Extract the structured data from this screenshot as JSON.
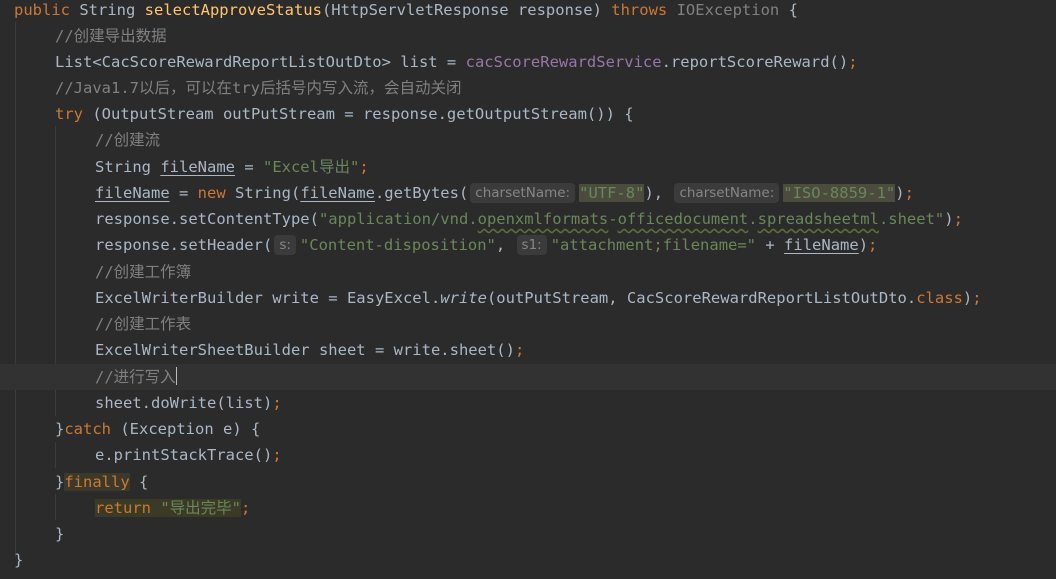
{
  "code": {
    "l1": {
      "public": "public ",
      "type": "String ",
      "method": "selectApproveStatus",
      "params": "(HttpServletResponse response) ",
      "throws": "throws ",
      "exc": "IOException",
      "brace": " {"
    },
    "l2": {
      "comment": "//创建导出数据"
    },
    "l3": {
      "decl": "List<CacScoreRewardReportListOutDto> list = ",
      "field": "cacScoreRewardService",
      "call": ".reportScoreReward()",
      "semi": ";"
    },
    "l4": {
      "comment": "//Java1.7以后，可以在try后括号内写入流，会自动关闭"
    },
    "l5": {
      "try": "try ",
      "rest": "(OutputStream outPutStream = response.getOutputStream()) {"
    },
    "l6": {
      "comment": "//创建流"
    },
    "l7": {
      "type": "String ",
      "var": "fileName",
      "eq": " = ",
      "str": "\"Excel导出\"",
      "semi": ";"
    },
    "l8": {
      "var": "fileName",
      "eq": " = ",
      "new": "new ",
      "ctor": "String(",
      "var2": "fileName",
      "call": ".getBytes(",
      "hint1": "charsetName:",
      "str1": "\"UTF-8\"",
      "mid": "),",
      "hint2": "charsetName:",
      "str2": "\"ISO-8859-1\"",
      "end": ")",
      "semi": ";"
    },
    "l9": {
      "pre": "response.setContentType(",
      "s_a": "\"application/vnd.",
      "s_b": "openxmlformats",
      "s_c": "-",
      "s_d": "officedocument",
      "s_e": ".",
      "s_f": "spreadsheetml",
      "s_g": ".sheet\"",
      "end": ")",
      "semi": ";"
    },
    "l10": {
      "pre": "response.setHeader(",
      "hint1": "s:",
      "str1": "\"Content-disposition\"",
      "comma": ", ",
      "hint2": "s1:",
      "str2": "\"attachment;filename=\"",
      "plus": " + ",
      "var": "fileName",
      "end": ")",
      "semi": ";"
    },
    "l11": {
      "comment": "//创建工作簿"
    },
    "l12": {
      "pre": "ExcelWriterBuilder write = EasyExcel.",
      "write": "write",
      "args": "(outPutStream, CacScoreRewardReportListOutDto.",
      "cls": "class",
      "end": ")",
      "semi": ";"
    },
    "l13": {
      "comment": "//创建工作表"
    },
    "l14": {
      "pre": "ExcelWriterSheetBuilder sheet = write.sheet()",
      "semi": ";"
    },
    "l15": {
      "comment": "//进行写入"
    },
    "l16": {
      "pre": "sheet.doWrite(list)",
      "semi": ";"
    },
    "l17": {
      "brace": "}",
      "catch": "catch ",
      "rest": "(Exception e) {"
    },
    "l18": {
      "pre": "e.printStackTrace()",
      "semi": ";"
    },
    "l19": {
      "brace": "}",
      "finally": "finally",
      "rest": " {"
    },
    "l20": {
      "ret": "return ",
      "str": "\"导出完毕\"",
      "semi": ";"
    },
    "l21": {
      "brace": "}"
    },
    "l22": {
      "brace": "}"
    }
  },
  "colors": {
    "background": "#2b2b2b",
    "keyword": "#cc7832",
    "method": "#ffc66d",
    "comment": "#808080",
    "string": "#6a8759",
    "field": "#9876aa",
    "text": "#a9b7c6"
  }
}
